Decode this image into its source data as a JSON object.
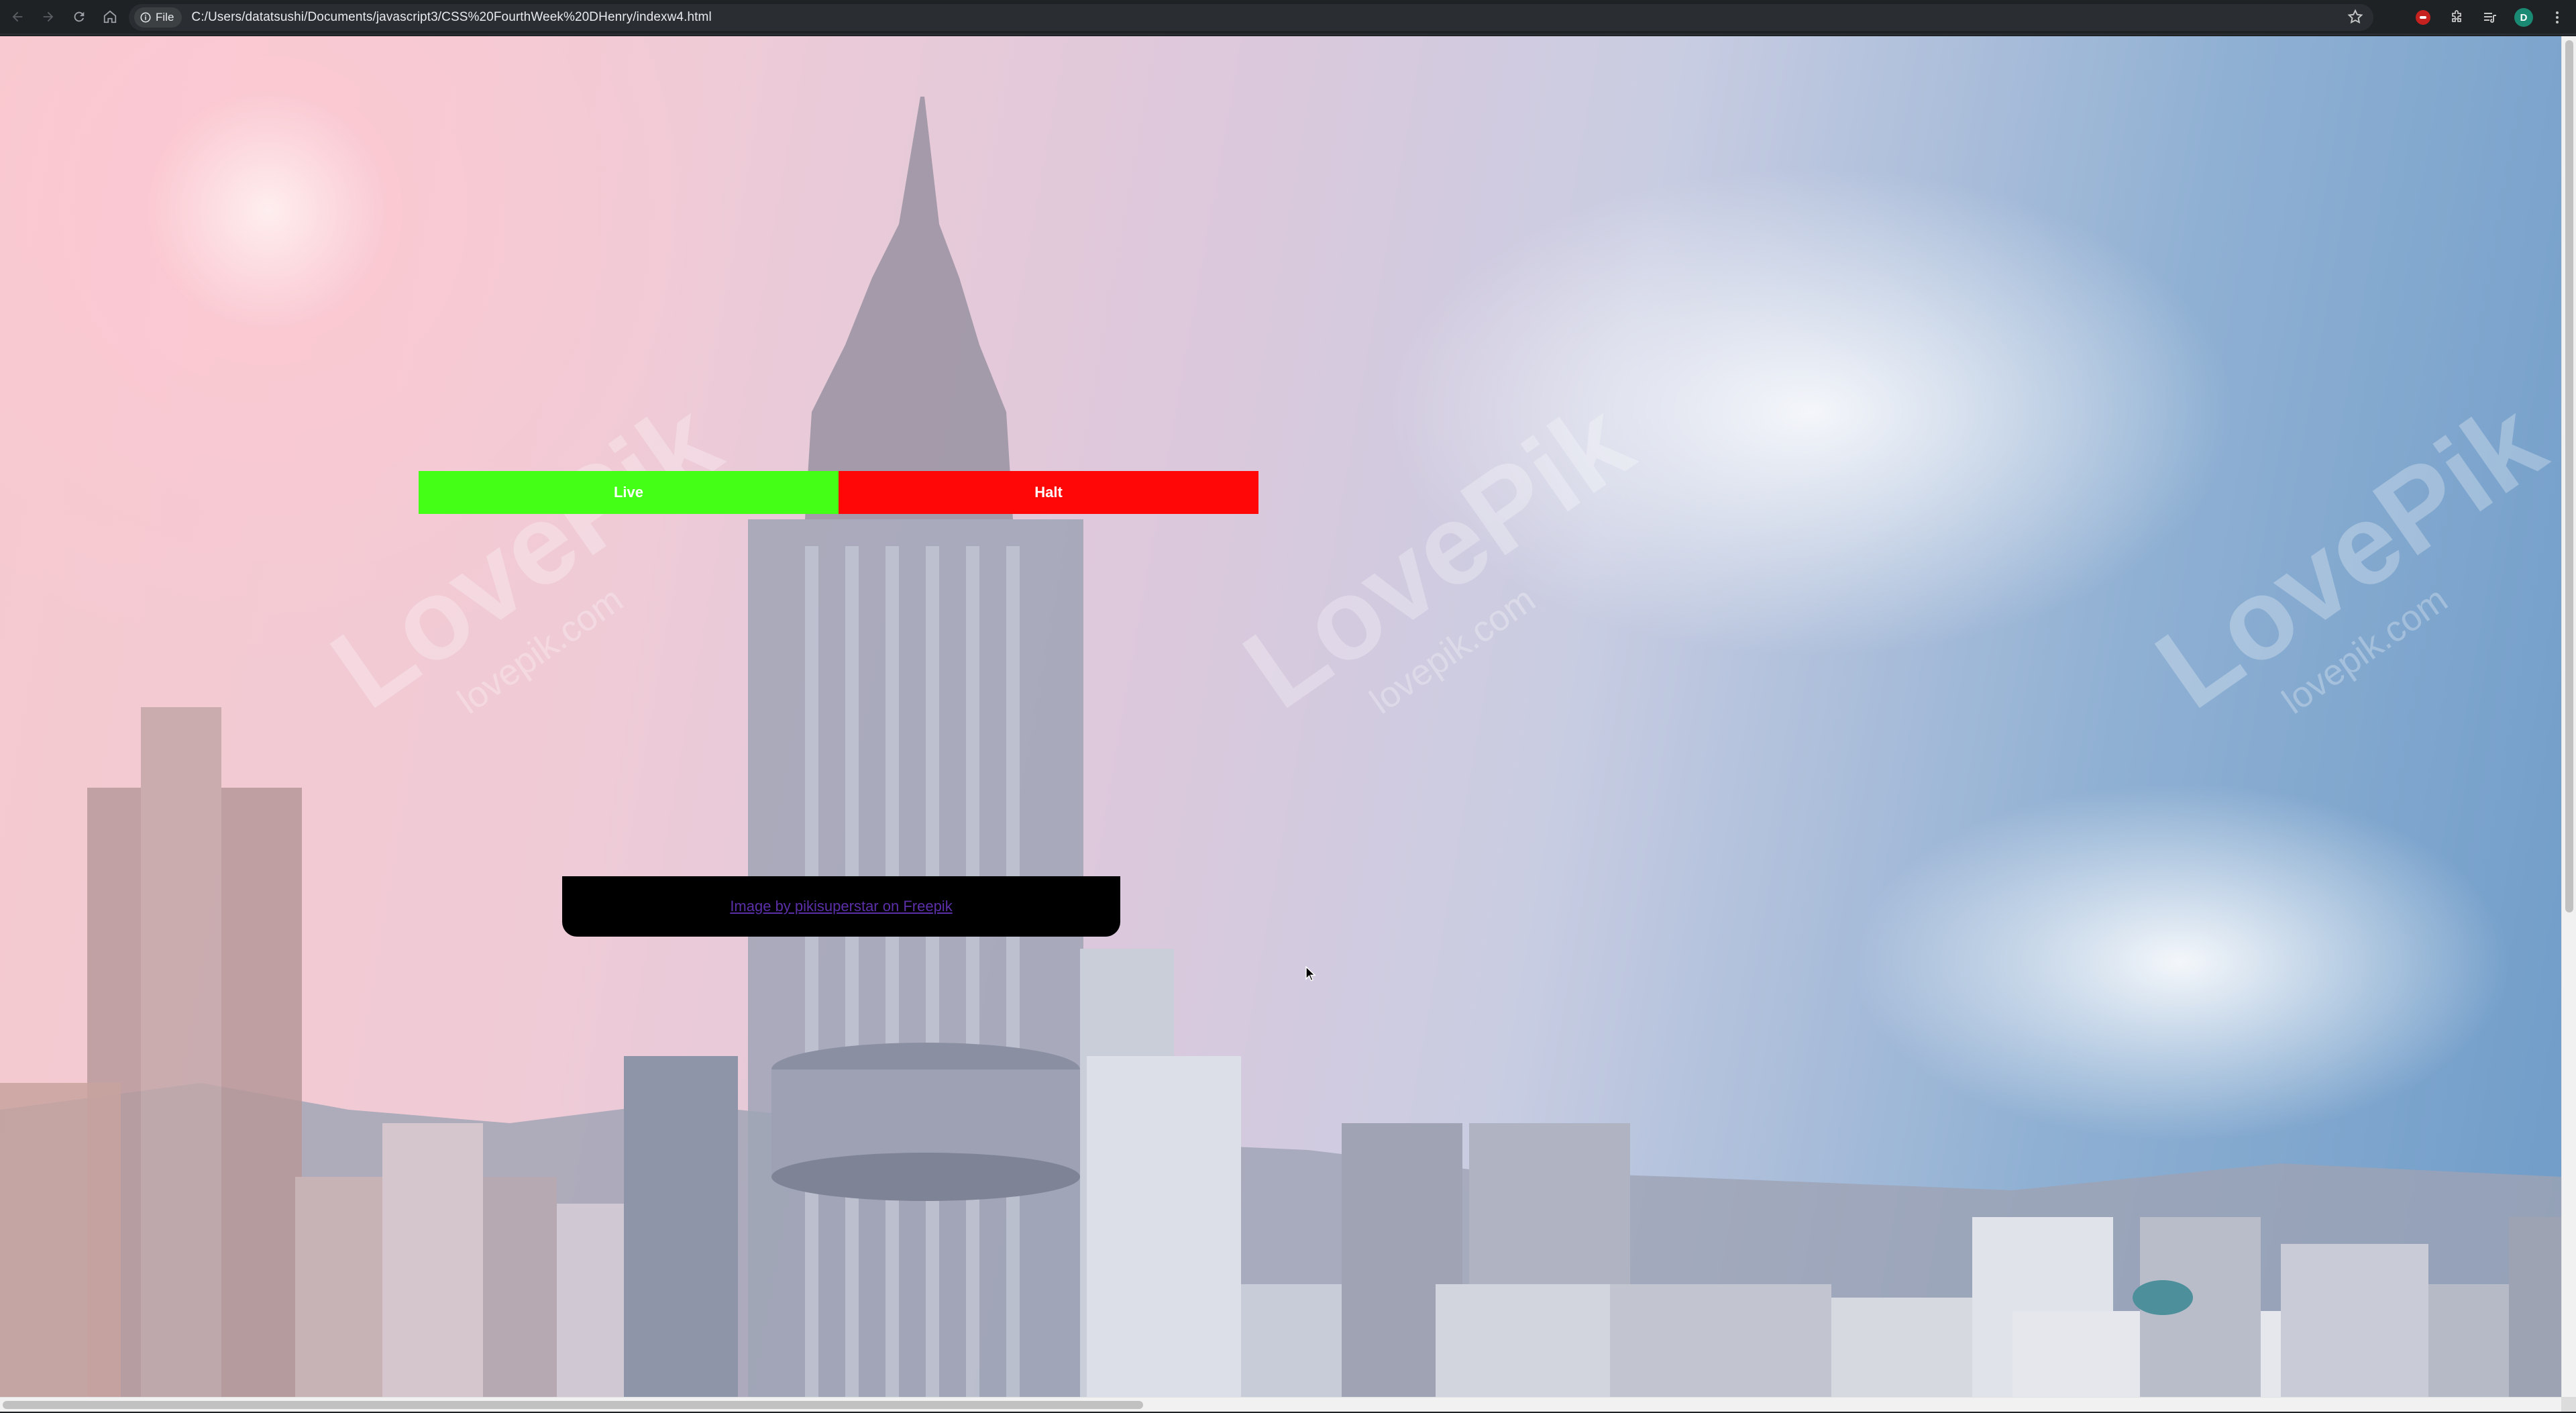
{
  "browser": {
    "file_chip_label": "File",
    "url": "C:/Users/datatsushi/Documents/javascript3/CSS%20FourthWeek%20DHenry/indexw4.html",
    "profile_initial": "D"
  },
  "page": {
    "buttons": {
      "live_label": "Live",
      "halt_label": "Halt",
      "live_color": "#44ff16",
      "halt_color": "#ff0707"
    },
    "credit": {
      "link_text": "Image by pikisuperstar on Freepik"
    },
    "watermark": {
      "brand": "LovePik",
      "domain": "lovepik.com"
    }
  }
}
